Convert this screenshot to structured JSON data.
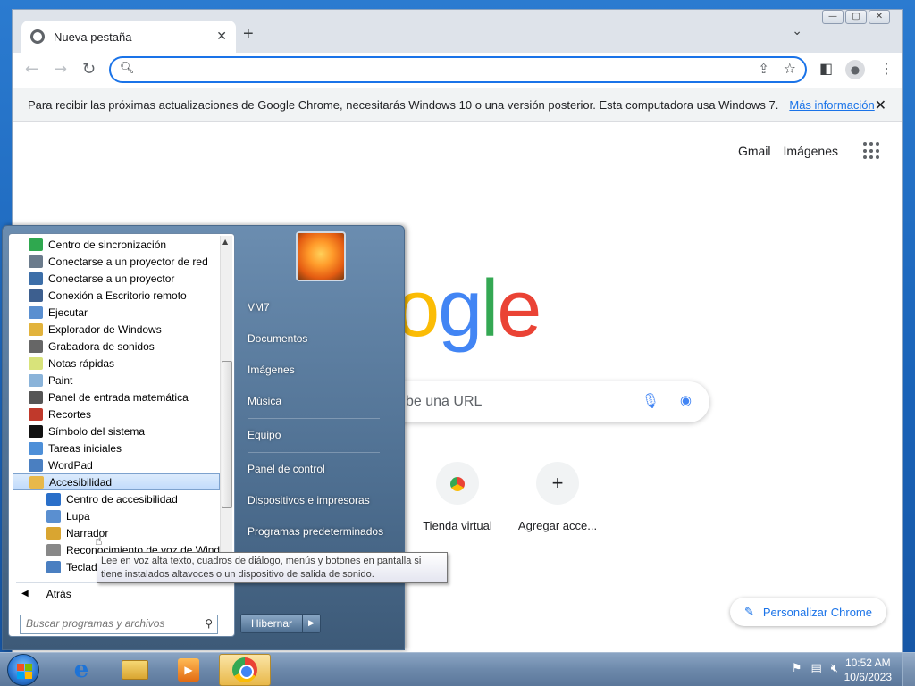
{
  "chrome": {
    "tab_title": "Nueva pestaña",
    "tab_close": "✕",
    "new_tab": "+",
    "tab_menu": "⌄",
    "window_controls": [
      "—",
      "▢",
      "✕"
    ],
    "omnibox_value": "",
    "infobar": {
      "message": "Para recibir las próximas actualizaciones de Google Chrome, necesitarás Windows 10 o una versión posterior. Esta computadora usa Windows 7.",
      "link": "Más información",
      "close": "✕"
    },
    "ntp": {
      "links": [
        "Gmail",
        "Imágenes"
      ],
      "logo_letters": [
        "o",
        "o",
        "g",
        "l",
        "e"
      ],
      "logo_colors": [
        "#ea4335",
        "#fbbc05",
        "#4285f4",
        "#34a853",
        "#ea4335"
      ],
      "search_placeholder": "be una URL",
      "shortcuts": [
        {
          "label": "Tienda virtual",
          "icon": "chrome-store-icon"
        },
        {
          "label": "Agregar acce...",
          "icon": "plus-icon",
          "glyph": "+"
        }
      ],
      "customize": "Personalizar Chrome"
    }
  },
  "start_menu": {
    "programs": [
      {
        "label": "Centro de sincronización",
        "icon": "sync-icon",
        "color": "#2fa84f"
      },
      {
        "label": "Conectarse a un proyector de red",
        "icon": "network-projector-icon",
        "color": "#6b7b8c"
      },
      {
        "label": "Conectarse a un proyector",
        "icon": "projector-icon",
        "color": "#3c6ea8"
      },
      {
        "label": "Conexión a Escritorio remoto",
        "icon": "remote-desktop-icon",
        "color": "#3d5f8f"
      },
      {
        "label": "Ejecutar",
        "icon": "run-icon",
        "color": "#5a8fd0"
      },
      {
        "label": "Explorador de Windows",
        "icon": "explorer-icon",
        "color": "#e2b33c"
      },
      {
        "label": "Grabadora de sonidos",
        "icon": "microphone-icon",
        "color": "#666666"
      },
      {
        "label": "Notas rápidas",
        "icon": "sticky-notes-icon",
        "color": "#d8e37a"
      },
      {
        "label": "Paint",
        "icon": "paint-icon",
        "color": "#8ab3d9"
      },
      {
        "label": "Panel de entrada matemática",
        "icon": "math-input-icon",
        "color": "#555555"
      },
      {
        "label": "Recortes",
        "icon": "snipping-icon",
        "color": "#c0392b"
      },
      {
        "label": "Símbolo del sistema",
        "icon": "cmd-icon",
        "color": "#111111"
      },
      {
        "label": "Tareas iniciales",
        "icon": "getting-started-icon",
        "color": "#4d8fd8"
      },
      {
        "label": "WordPad",
        "icon": "wordpad-icon",
        "color": "#4a7fc1"
      }
    ],
    "selected_folder": {
      "label": "Accesibilidad",
      "icon": "folder-icon",
      "color": "#e7b84a"
    },
    "sub_items": [
      {
        "label": "Centro de accesibilidad",
        "icon": "accessibility-icon",
        "color": "#2a6fc9"
      },
      {
        "label": "Lupa",
        "icon": "magnifier-icon",
        "color": "#5a8fd0"
      },
      {
        "label": "Narrador",
        "icon": "narrator-icon",
        "color": "#d9a531"
      },
      {
        "label": "Reconocimiento de voz de Wind",
        "icon": "speech-icon",
        "color": "#888888"
      },
      {
        "label": "Teclad",
        "icon": "keyboard-icon",
        "color": "#4a7fc1"
      }
    ],
    "back": "Atrás",
    "search_placeholder": "Buscar programas y archivos",
    "right_links": {
      "user": "VM7",
      "documents": "Documentos",
      "pictures": "Imágenes",
      "music": "Música",
      "computer": "Equipo",
      "control_panel": "Panel de control",
      "devices": "Dispositivos e impresoras",
      "default_programs": "Programas predeterminados"
    },
    "shutdown": "Hibernar",
    "tooltip": "Lee en voz alta texto, cuadros de diálogo, menús y botones en pantalla si tiene instalados altavoces o un dispositivo de salida de sonido."
  },
  "taskbar": {
    "time": "10:52 AM",
    "date": "10/6/2023"
  }
}
